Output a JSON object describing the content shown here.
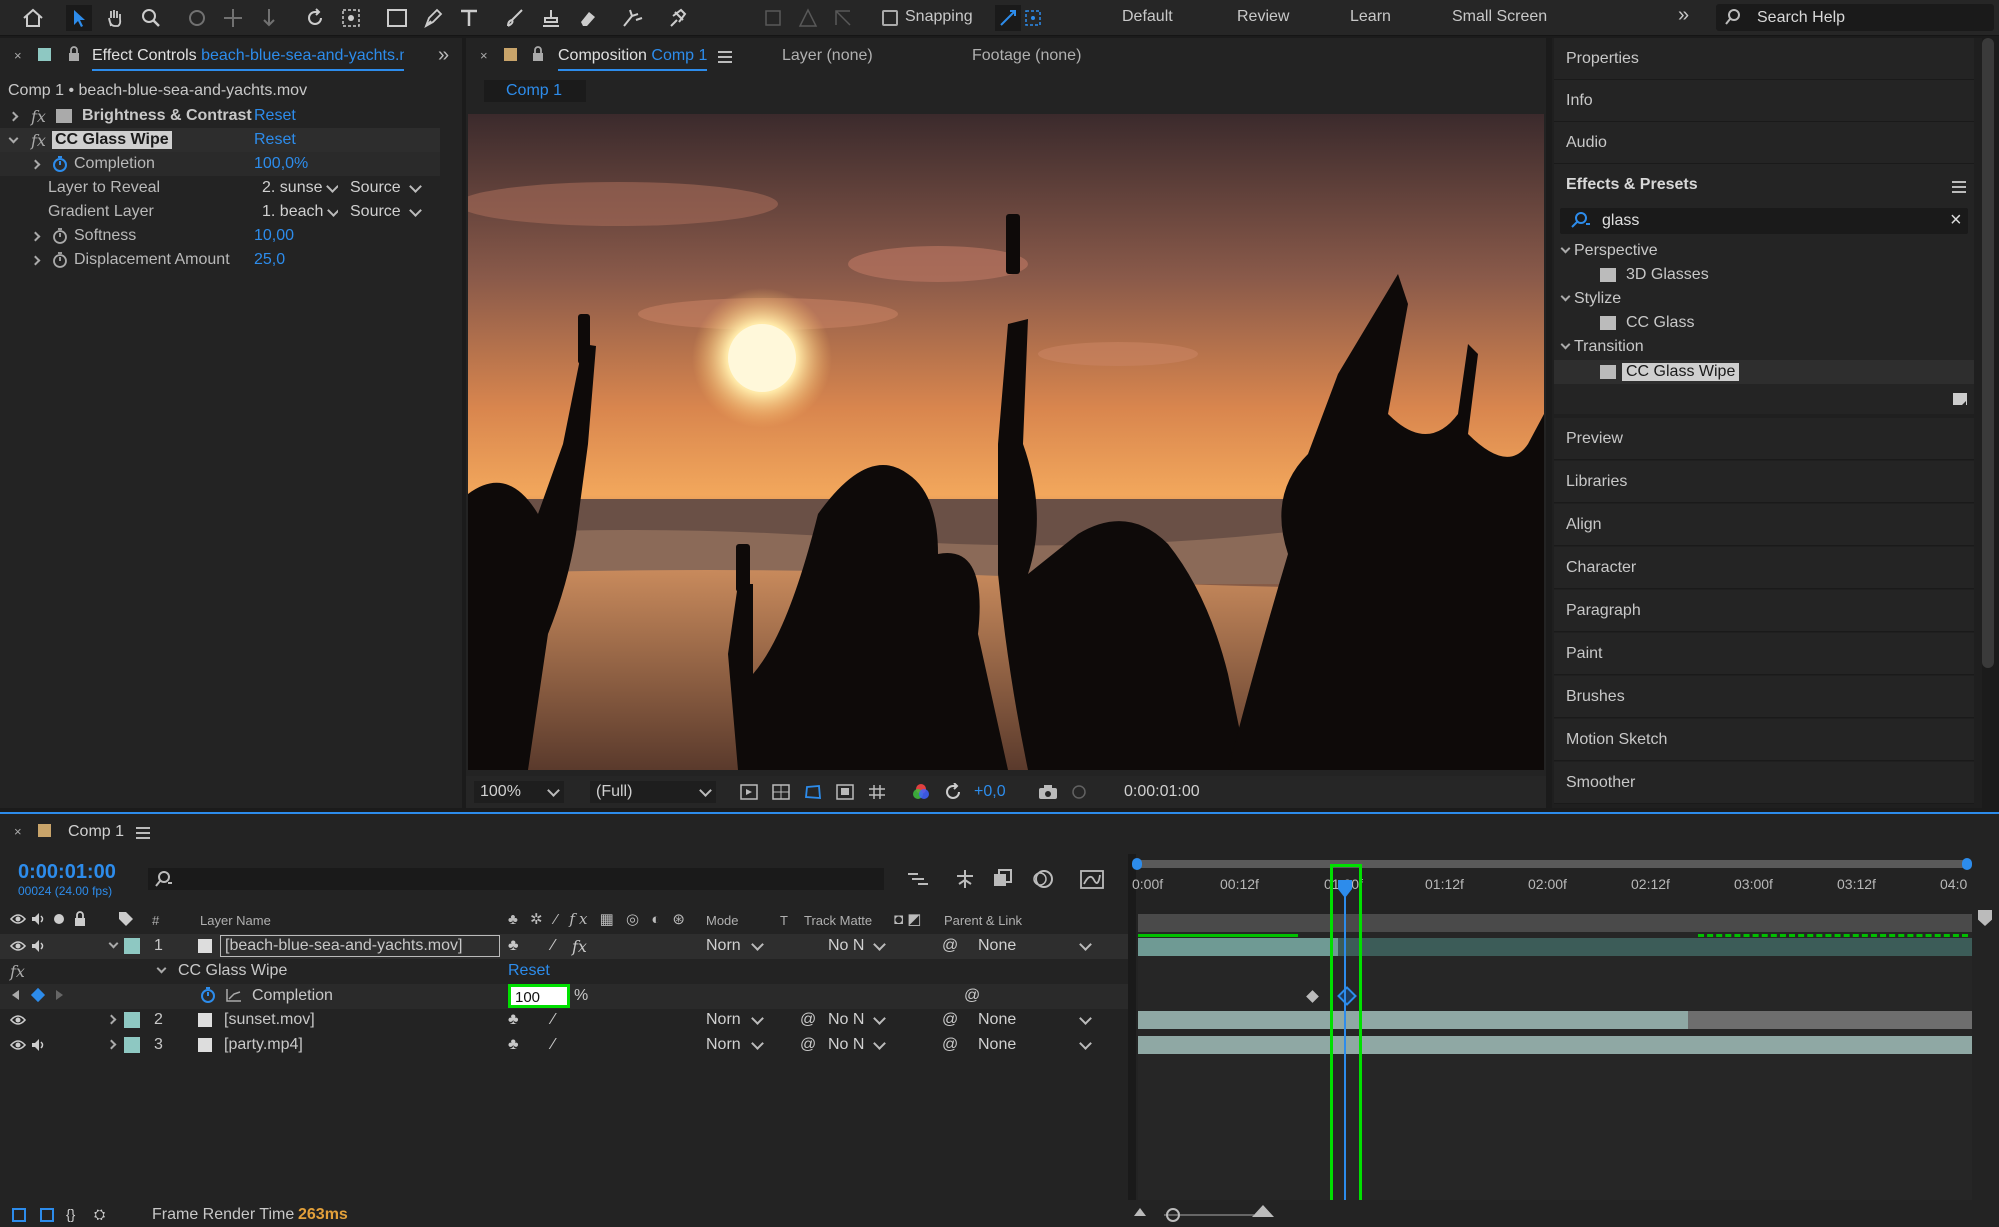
{
  "toolbar": {
    "snapping": "Snapping",
    "workspaces": [
      "Default",
      "Review",
      "Learn",
      "Small Screen"
    ],
    "search_placeholder": "Search Help",
    "more": "»"
  },
  "effect_controls": {
    "tab_label": "Effect Controls",
    "tab_file": "beach-blue-sea-and-yachts.m",
    "subtitle": "Comp 1 • beach-blue-sea-and-yachts.mov",
    "effects": [
      {
        "name": "Brightness & Contrast",
        "reset": "Reset"
      },
      {
        "name": "CC Glass Wipe",
        "reset": "Reset"
      }
    ],
    "props": {
      "completion_label": "Completion",
      "completion_value": "100,0%",
      "layer_to_reveal_label": "Layer to Reveal",
      "layer_to_reveal_value": "2. sunse",
      "gradient_layer_label": "Gradient Layer",
      "gradient_layer_value": "1. beach",
      "source": "Source",
      "softness_label": "Softness",
      "softness_value": "10,00",
      "displacement_label": "Displacement Amount",
      "displacement_value": "25,0"
    }
  },
  "composition": {
    "tab_prefix": "Composition",
    "tab_name": "Comp 1",
    "layer_tab": "Layer (none)",
    "footage_tab": "Footage (none)",
    "subtab": "Comp 1",
    "zoom": "100%",
    "resolution": "(Full)",
    "exposure": "+0,0",
    "timecode": "0:00:01:00"
  },
  "right_panel": {
    "properties": "Properties",
    "info": "Info",
    "audio": "Audio",
    "effects_presets": "Effects & Presets",
    "search_value": "glass",
    "tree": [
      {
        "folder": "Perspective",
        "item": "3D Glasses"
      },
      {
        "folder": "Stylize",
        "item": "CC Glass"
      },
      {
        "folder": "Transition",
        "item": "CC Glass Wipe"
      }
    ],
    "panels": [
      "Preview",
      "Libraries",
      "Align",
      "Character",
      "Paragraph",
      "Paint",
      "Brushes",
      "Motion Sketch",
      "Smoother"
    ]
  },
  "timeline": {
    "tab": "Comp 1",
    "timecode": "0:00:01:00",
    "fps": "00024 (24.00 fps)",
    "headers": {
      "num": "#",
      "layer_name": "Layer Name",
      "mode": "Mode",
      "t": "T",
      "track_matte": "Track Matte",
      "parent": "Parent & Link"
    },
    "layers": [
      {
        "num": "1",
        "name": "[beach-blue-sea-and-yachts.mov]",
        "mode": "Norn",
        "matte": "No N",
        "parent": "None"
      },
      {
        "num": "2",
        "name": "[sunset.mov]",
        "mode": "Norn",
        "matte": "No N",
        "parent": "None"
      },
      {
        "num": "3",
        "name": "[party.mp4]",
        "mode": "Norn",
        "matte": "No N",
        "parent": "None"
      }
    ],
    "effect_name": "CC Glass Wipe",
    "effect_reset": "Reset",
    "completion_label": "Completion",
    "completion_value": "100",
    "percent": "%",
    "fx": "fx",
    "ruler": [
      "0:00f",
      "00:12f",
      "01:00f",
      "01:12f",
      "02:00f",
      "02:12f",
      "03:00f",
      "03:12f",
      "04:0"
    ],
    "ruler_current": "01:00f",
    "frame_render_label": "Frame Render Time",
    "frame_render_value": "263ms"
  },
  "colors": {
    "accent": "#2d8ceb",
    "highlight": "#00e000",
    "label": "#8ec8c2",
    "panel": "#232323"
  }
}
